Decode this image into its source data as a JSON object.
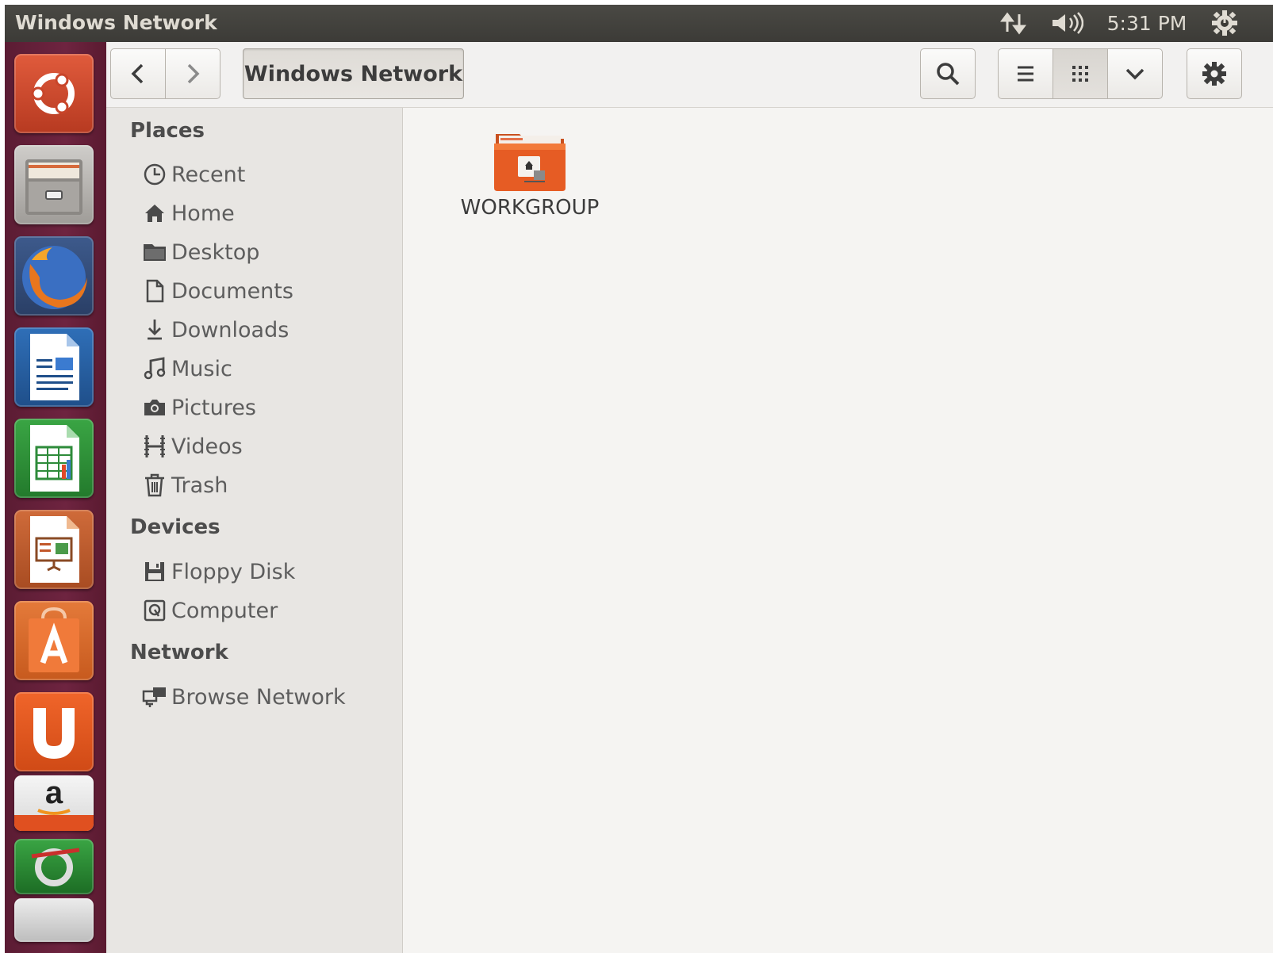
{
  "window": {
    "title": "Windows Network"
  },
  "panel": {
    "clock": "5:31 PM",
    "network_icon": "network-transfer-icon",
    "volume_icon": "volume-icon",
    "session_icon": "power-gear-icon"
  },
  "launcher": {
    "items": [
      {
        "name": "dash-home",
        "icon": "ubuntu-logo-icon"
      },
      {
        "name": "files",
        "icon": "file-cabinet-icon"
      },
      {
        "name": "firefox",
        "icon": "firefox-icon"
      },
      {
        "name": "writer",
        "icon": "libreoffice-writer-icon"
      },
      {
        "name": "calc",
        "icon": "libreoffice-calc-icon"
      },
      {
        "name": "impress",
        "icon": "libreoffice-impress-icon"
      },
      {
        "name": "software-center",
        "icon": "shopping-bag-icon"
      },
      {
        "name": "ubuntu-one",
        "icon": "ubuntu-one-icon"
      },
      {
        "name": "amazon",
        "icon": "amazon-icon"
      }
    ],
    "amazon_letter": "a"
  },
  "toolbar": {
    "back_icon": "chevron-left-icon",
    "forward_icon": "chevron-right-icon",
    "path_label": "Windows Network",
    "search_icon": "search-icon",
    "list_view_icon": "list-view-icon",
    "grid_view_icon": "grid-view-icon",
    "view_menu_icon": "chevron-down-icon",
    "settings_icon": "gear-icon"
  },
  "sidebar": {
    "places_heading": "Places",
    "places": [
      {
        "label": "Recent",
        "icon": "clock-icon"
      },
      {
        "label": "Home",
        "icon": "home-icon"
      },
      {
        "label": "Desktop",
        "icon": "folder-icon"
      },
      {
        "label": "Documents",
        "icon": "document-icon"
      },
      {
        "label": "Downloads",
        "icon": "download-icon"
      },
      {
        "label": "Music",
        "icon": "music-note-icon"
      },
      {
        "label": "Pictures",
        "icon": "camera-icon"
      },
      {
        "label": "Videos",
        "icon": "film-icon"
      },
      {
        "label": "Trash",
        "icon": "trash-icon"
      }
    ],
    "devices_heading": "Devices",
    "devices": [
      {
        "label": "Floppy Disk",
        "icon": "floppy-icon"
      },
      {
        "label": "Computer",
        "icon": "harddisk-icon"
      }
    ],
    "network_heading": "Network",
    "network": [
      {
        "label": "Browse Network",
        "icon": "network-icon"
      }
    ]
  },
  "content": {
    "items": [
      {
        "label": "WORKGROUP",
        "icon": "network-folder-icon"
      }
    ]
  },
  "colors": {
    "panel_bg": "#3c3b37",
    "launcher_bg": "#6e2440",
    "accent_orange": "#e95420",
    "sidebar_bg": "#e8e6e3",
    "content_bg": "#f5f4f2"
  }
}
